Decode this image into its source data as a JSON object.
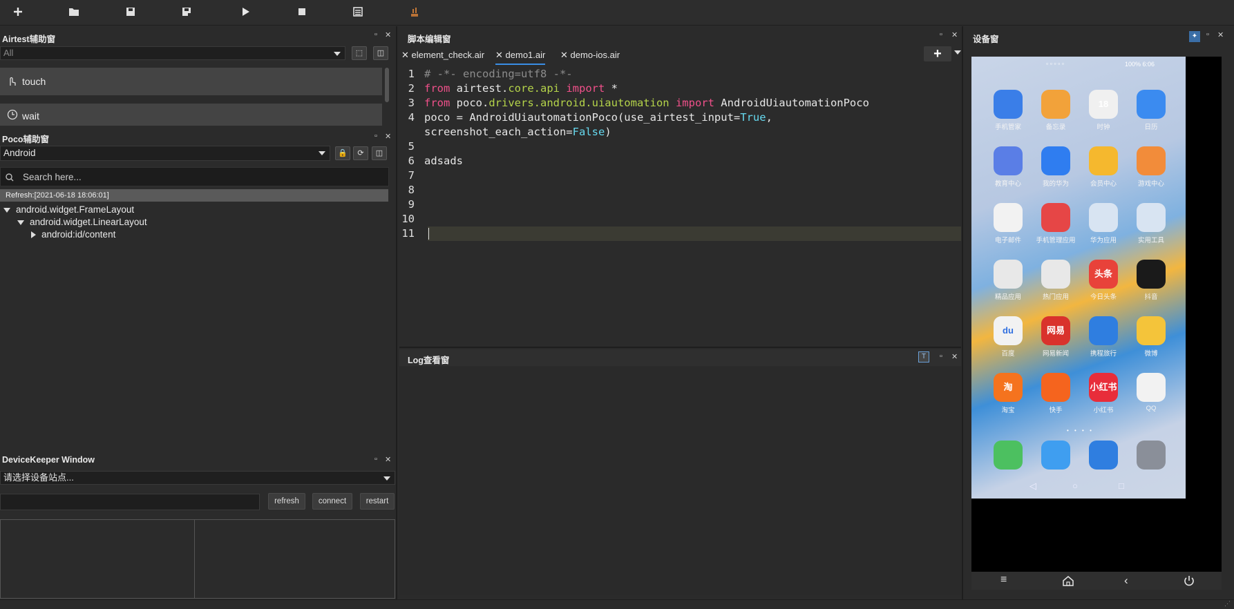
{
  "toolbar": {
    "items": [
      "new-file-icon",
      "open-folder-icon",
      "save-icon",
      "save-as-icon",
      "run-icon",
      "stop-icon",
      "log-icon",
      "report-icon"
    ]
  },
  "airtest": {
    "title": "Airtest辅助窗",
    "filter_value": "All",
    "commands": [
      "touch",
      "wait"
    ]
  },
  "poco": {
    "title": "Poco辅助窗",
    "platform": "Android",
    "search_placeholder": "Search here...",
    "refresh_status": "Refresh:[2021-06-18 18:06:01]",
    "tree": [
      "android.widget.FrameLayout",
      "android.widget.LinearLayout",
      "android:id/content"
    ]
  },
  "editor": {
    "title": "脚本编辑窗",
    "tabs": [
      "element_check.air",
      "demo1.air",
      "demo-ios.air"
    ],
    "active_tab": "demo1.air",
    "line_numbers": [
      "1",
      "2",
      "3",
      "4",
      "5",
      "6",
      "7",
      "8",
      "9",
      "10",
      "11"
    ],
    "code": {
      "l1": "# -*- encoding=utf8 -*-",
      "l2_kw1": "from",
      "l2_mod_a": " airtest.",
      "l2_mod_b": "core.api",
      "l2_sp": " ",
      "l2_kw2": "import",
      "l2_rest": " *",
      "l3_kw1": "from",
      "l3_a": " poco.",
      "l3_b": "drivers.android.uiautomation",
      "l3_sp": " ",
      "l3_kw2": "import",
      "l3_rest": " AndroidUiautomationPoco",
      "l4_a": "poco = AndroidUiautomationPoco(use_airtest_input=",
      "l4_true": "True",
      "l4_c": ",",
      "l4b_a": "screenshot_each_action=",
      "l4b_false": "False",
      "l4b_c": ")",
      "l6": "adsads"
    }
  },
  "log": {
    "title": "Log查看窗"
  },
  "devicekeeper": {
    "title": "DeviceKeeper Window",
    "station_placeholder": "请选择设备站点...",
    "buttons": [
      "refresh",
      "connect",
      "restart"
    ]
  },
  "device": {
    "title": "设备窗",
    "status_bar": "100%  6:06",
    "apps": [
      {
        "label": "手机管家",
        "color": "#3a7ee8"
      },
      {
        "label": "备忘录",
        "color": "#f2a23a"
      },
      {
        "label": "时钟",
        "color": "#f0f0f0"
      },
      {
        "label": "日历",
        "color": "#3b8bf0"
      },
      {
        "label": "教育中心",
        "color": "#5a7ee6"
      },
      {
        "label": "我的华为",
        "color": "#2f7df0"
      },
      {
        "label": "会员中心",
        "color": "#f5b82e"
      },
      {
        "label": "游戏中心",
        "color": "#f28c3a"
      },
      {
        "label": "电子邮件",
        "color": "#f2f2f2"
      },
      {
        "label": "手机管理应用",
        "color": "#e64646"
      },
      {
        "label": "华为应用",
        "color": "#d8e4f2"
      },
      {
        "label": "实用工具",
        "color": "#d8e4f2"
      },
      {
        "label": "精品应用",
        "color": "#e8e8e8"
      },
      {
        "label": "热门应用",
        "color": "#e8e8e8"
      },
      {
        "label": "今日头条",
        "color": "#e8423a"
      },
      {
        "label": "抖音",
        "color": "#1a1a1a"
      },
      {
        "label": "百度",
        "color": "#f2f2f2"
      },
      {
        "label": "网易新闻",
        "color": "#d9322c"
      },
      {
        "label": "携程旅行",
        "color": "#2f7ee0"
      },
      {
        "label": "微博",
        "color": "#f4c43a"
      },
      {
        "label": "淘宝",
        "color": "#f5731e"
      },
      {
        "label": "快手",
        "color": "#f5641e"
      },
      {
        "label": "小红书",
        "color": "#e82d3a"
      },
      {
        "label": "QQ",
        "color": "#f2f2f2"
      }
    ],
    "dock": [
      {
        "name": "phone-icon",
        "color": "#4cc060"
      },
      {
        "name": "messages-icon",
        "color": "#3f9ef0"
      },
      {
        "name": "browser-icon",
        "color": "#2f7ee0"
      },
      {
        "name": "settings-icon",
        "color": "#8a8f99"
      }
    ],
    "app_icon_texts": [
      "18",
      "网易",
      "头条",
      "du",
      "淘",
      "小红书"
    ]
  }
}
